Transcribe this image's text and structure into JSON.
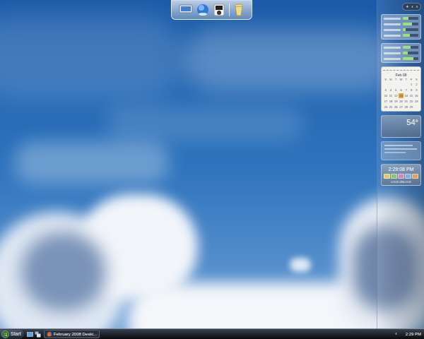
{
  "sidebar": {
    "controls": [
      "+",
      "‹",
      "›"
    ],
    "meters_top": [
      {
        "level": 0.35
      },
      {
        "level": 0.6
      },
      {
        "level": 0.2
      },
      {
        "level": 0.45
      }
    ],
    "meters_bottom": [
      {
        "level": 0.5
      },
      {
        "level": 0.3
      },
      {
        "level": 0.7
      }
    ],
    "calendar": {
      "month": "Feb 08",
      "weekdays": [
        "S",
        "M",
        "T",
        "W",
        "T",
        "F",
        "S"
      ],
      "weeks": [
        [
          {
            "day": "",
            "selected": false
          },
          {
            "day": "",
            "selected": false
          },
          {
            "day": "",
            "selected": false
          },
          {
            "day": "",
            "selected": false
          },
          {
            "day": "",
            "selected": false
          },
          {
            "day": "1",
            "selected": false
          },
          {
            "day": "2",
            "selected": false
          }
        ],
        [
          {
            "day": "3",
            "selected": false
          },
          {
            "day": "4",
            "selected": false
          },
          {
            "day": "5",
            "selected": false
          },
          {
            "day": "6",
            "selected": false
          },
          {
            "day": "7",
            "selected": false
          },
          {
            "day": "8",
            "selected": false
          },
          {
            "day": "9",
            "selected": false
          }
        ],
        [
          {
            "day": "10",
            "selected": false
          },
          {
            "day": "11",
            "selected": false
          },
          {
            "day": "12",
            "selected": false
          },
          {
            "day": "13",
            "selected": true
          },
          {
            "day": "14",
            "selected": false
          },
          {
            "day": "15",
            "selected": false
          },
          {
            "day": "16",
            "selected": false
          }
        ],
        [
          {
            "day": "17",
            "selected": false
          },
          {
            "day": "18",
            "selected": false
          },
          {
            "day": "19",
            "selected": false
          },
          {
            "day": "20",
            "selected": false
          },
          {
            "day": "21",
            "selected": false
          },
          {
            "day": "22",
            "selected": false
          },
          {
            "day": "23",
            "selected": false
          }
        ],
        [
          {
            "day": "24",
            "selected": false
          },
          {
            "day": "25",
            "selected": false
          },
          {
            "day": "26",
            "selected": false
          },
          {
            "day": "27",
            "selected": false
          },
          {
            "day": "28",
            "selected": false
          },
          {
            "day": "29",
            "selected": false
          },
          {
            "day": "",
            "selected": false
          }
        ]
      ]
    },
    "weather": {
      "temperature": "54°"
    },
    "clock": {
      "time": "2:29:08 PM",
      "swatches": [
        {
          "color": "#e4c86a"
        },
        {
          "color": "#8fc07a"
        },
        {
          "color": "#c98bb0"
        },
        {
          "color": "#7fb0d8"
        },
        {
          "color": "#d9a46a"
        }
      ],
      "caption": "LOCK UNLOCK"
    }
  },
  "taskbar": {
    "start": "Start",
    "tasks": [
      {
        "label": "February 2008 Deskt...",
        "selected": false
      }
    ],
    "tray_arrow": "‹",
    "clock": "2:29 PM"
  }
}
